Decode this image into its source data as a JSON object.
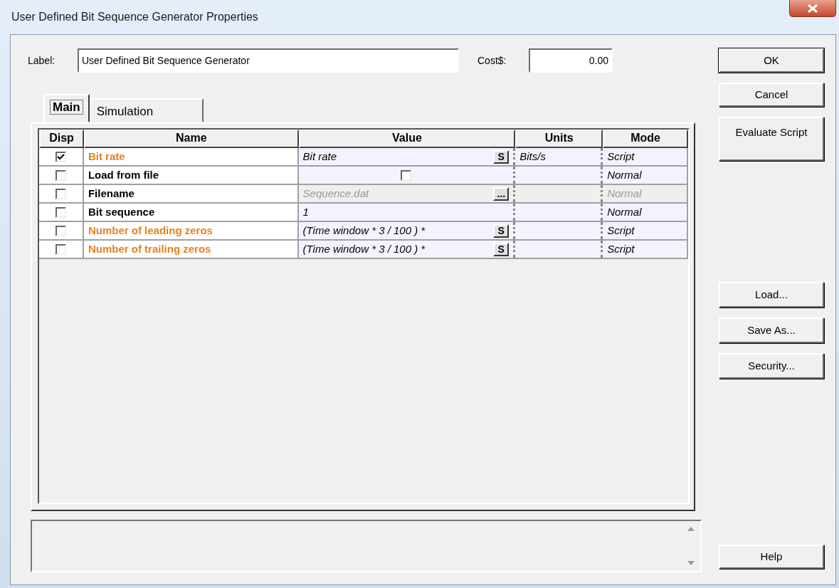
{
  "window": {
    "title": "User Defined Bit Sequence Generator Properties"
  },
  "label_field": {
    "label": "Label:",
    "value": "User Defined Bit Sequence Generator"
  },
  "cost_field": {
    "label": "Cost$:",
    "value": "0.00"
  },
  "tabs": [
    {
      "label": "Main",
      "selected": true
    },
    {
      "label": "Simulation",
      "selected": false
    }
  ],
  "table": {
    "columns": [
      "Disp",
      "Name",
      "Value",
      "Units",
      "Mode"
    ],
    "rows": [
      {
        "disp_checked": true,
        "name": "Bit rate",
        "color": "#e8801e",
        "kind": "script",
        "value": "Bit rate",
        "button": "S",
        "units": "Bits/s",
        "mode": "Script",
        "disabled": false
      },
      {
        "disp_checked": false,
        "name": "Load from file",
        "color": "#000000",
        "kind": "checkbox",
        "checked": false,
        "mode": "Normal",
        "disabled": false
      },
      {
        "disp_checked": false,
        "name": "Filename",
        "color": "#000000",
        "kind": "file",
        "value": "Sequence.dat",
        "button": "...",
        "mode": "Normal",
        "disabled": true
      },
      {
        "disp_checked": false,
        "name": "Bit sequence",
        "color": "#000000",
        "kind": "text",
        "value": "1",
        "mode": "Normal",
        "disabled": false
      },
      {
        "disp_checked": false,
        "name": "Number of leading zeros",
        "color": "#e8801e",
        "kind": "script",
        "value": "(Time window * 3 / 100 ) *",
        "button": "S",
        "mode": "Script",
        "disabled": false
      },
      {
        "disp_checked": false,
        "name": "Number of trailing zeros",
        "color": "#e8801e",
        "kind": "script",
        "value": "(Time window * 3 / 100 ) *",
        "button": "S",
        "mode": "Script",
        "disabled": false
      }
    ]
  },
  "buttons_top": [
    {
      "label": "OK",
      "default": true
    },
    {
      "label": "Cancel",
      "default": false
    },
    {
      "label": "Evaluate Script",
      "default": false
    }
  ],
  "buttons_middle": [
    "Load...",
    "Save As...",
    "Security..."
  ],
  "help_button": "Help"
}
